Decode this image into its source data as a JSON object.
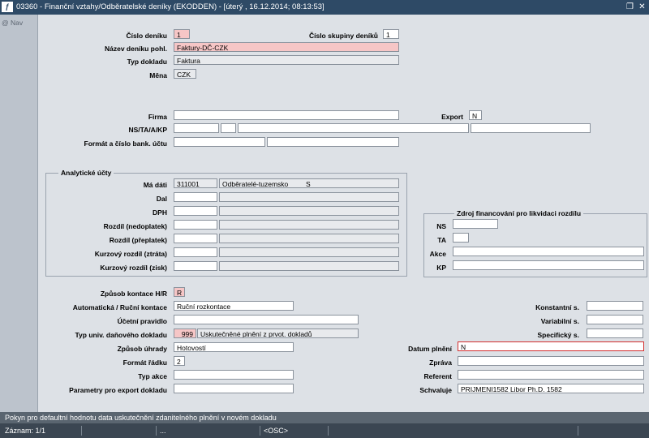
{
  "window": {
    "title": "03360 - Finanční vztahy/Odběratelské deníky (EKODDEN) - [úterý  , 16.12.2014; 08:13:53]",
    "app_icon": "ƒ"
  },
  "nav": {
    "label": "Nav"
  },
  "header": {
    "cislo_deniku_label": "Číslo deníku",
    "cislo_deniku": "1",
    "cislo_skupiny_label": "Číslo skupiny deníků",
    "cislo_skupiny": "1",
    "nazev_label": "Název deníku pohl.",
    "nazev": "Faktury-DČ-CZK",
    "typ_dokladu_label": "Typ dokladu",
    "typ_dokladu": "Faktura",
    "mena_label": "Měna",
    "mena": "CZK"
  },
  "firma": {
    "firma_label": "Firma",
    "firma": "",
    "export_label": "Export",
    "export": "N",
    "ns_label": "NS/TA/A/KP",
    "format_label": "Formát a číslo bank. účtu"
  },
  "analyticke": {
    "title": "Analytické účty",
    "rows": [
      {
        "label": "Má dáti",
        "code": "311001",
        "desc": "Odběratelé-tuzemsko",
        "flag": "S"
      },
      {
        "label": "Dal",
        "code": "",
        "desc": "",
        "flag": ""
      },
      {
        "label": "DPH",
        "code": "",
        "desc": "",
        "flag": ""
      },
      {
        "label": "Rozdíl (nedoplatek)",
        "code": "",
        "desc": "",
        "flag": ""
      },
      {
        "label": "Rozdíl (přeplatek)",
        "code": "",
        "desc": "",
        "flag": ""
      },
      {
        "label": "Kurzový rozdíl (ztráta)",
        "code": "",
        "desc": "",
        "flag": ""
      },
      {
        "label": "Kurzový rozdíl (zisk)",
        "code": "",
        "desc": "",
        "flag": ""
      }
    ]
  },
  "zdroj": {
    "title": "Zdroj financování pro likvidaci rozdílu",
    "ns_label": "NS",
    "ta_label": "TA",
    "akce_label": "Akce",
    "kp_label": "KP"
  },
  "kontace": {
    "zpusob_label": "Způsob kontace H/R",
    "zpusob": "R",
    "auto_label": "Automatická / Ruční kontace",
    "auto": "Ruční rozkontace",
    "ucetni_label": "Účetní pravidlo",
    "ucetni": "",
    "typ_dan_label": "Typ univ. daňového dokladu",
    "typ_dan_code": "999",
    "typ_dan_desc": "Uskutečněné plnění z prvot. dokladů",
    "uhrada_label": "Způsob úhrady",
    "uhrada": "Hotovostí",
    "format_label": "Formát řádku",
    "format": "2",
    "typ_akce_label": "Typ akce",
    "typ_akce": "",
    "parametry_label": "Parametry pro export dokladu",
    "parametry": ""
  },
  "right": {
    "konst_label": "Konstantní s.",
    "var_label": "Variabilní s.",
    "spec_label": "Specifický s.",
    "datum_label": "Datum plnění",
    "datum": "N",
    "zprava_label": "Zpráva",
    "referent_label": "Referent",
    "schvaluje_label": "Schvaluje",
    "schvaluje": "PRIJMENI1582 Libor Ph.D. 1582"
  },
  "status": {
    "hint": "Pokyn pro defaultní hodnotu data uskutečnění zdanitelného plnění  v novém dokladu",
    "record": "Záznam: 1/1",
    "seg1": "...",
    "seg2": "<OSC>"
  }
}
